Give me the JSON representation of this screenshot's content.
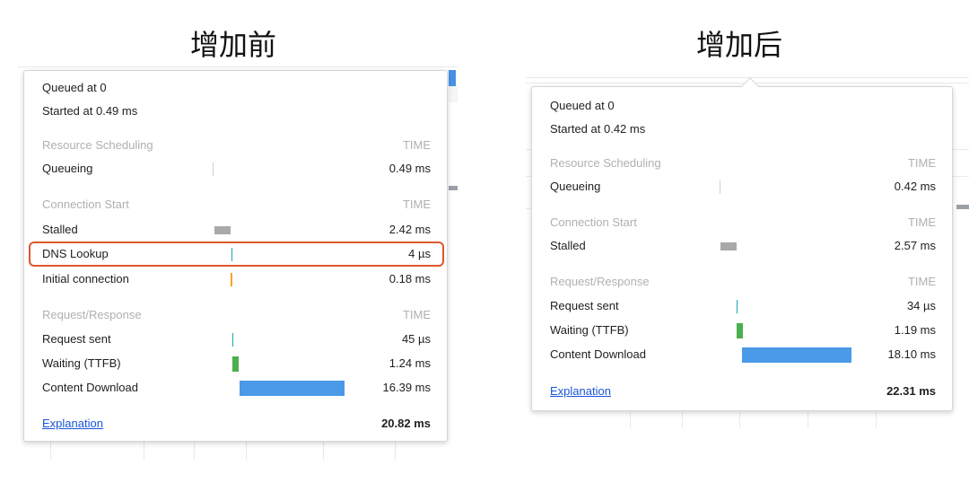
{
  "before": {
    "heading": "增加前",
    "queued": "Queued at 0",
    "started": "Started at 0.49 ms",
    "sections": [
      {
        "title": "Resource Scheduling",
        "time_label": "TIME",
        "rows": [
          {
            "label": "Queueing",
            "value": "0.49 ms"
          }
        ]
      },
      {
        "title": "Connection Start",
        "time_label": "TIME",
        "rows": [
          {
            "label": "Stalled",
            "value": "2.42 ms"
          },
          {
            "label": "DNS Lookup",
            "value": "4 µs"
          },
          {
            "label": "Initial connection",
            "value": "0.18 ms"
          }
        ]
      },
      {
        "title": "Request/Response",
        "time_label": "TIME",
        "rows": [
          {
            "label": "Request sent",
            "value": "45 µs"
          },
          {
            "label": "Waiting (TTFB)",
            "value": "1.24 ms"
          },
          {
            "label": "Content Download",
            "value": "16.39 ms"
          }
        ]
      }
    ],
    "explanation": "Explanation",
    "total": "20.82 ms"
  },
  "after": {
    "heading": "增加后",
    "queued": "Queued at 0",
    "started": "Started at 0.42 ms",
    "sections": [
      {
        "title": "Resource Scheduling",
        "time_label": "TIME",
        "rows": [
          {
            "label": "Queueing",
            "value": "0.42 ms"
          }
        ]
      },
      {
        "title": "Connection Start",
        "time_label": "TIME",
        "rows": [
          {
            "label": "Stalled",
            "value": "2.57 ms"
          }
        ]
      },
      {
        "title": "Request/Response",
        "time_label": "TIME",
        "rows": [
          {
            "label": "Request sent",
            "value": "34 µs"
          },
          {
            "label": "Waiting (TTFB)",
            "value": "1.19 ms"
          },
          {
            "label": "Content Download",
            "value": "18.10 ms"
          }
        ]
      }
    ],
    "explanation": "Explanation",
    "total": "22.31 ms"
  },
  "colors": {
    "highlight": "#e0562e",
    "link": "#1a55d8",
    "download_bar": "#4a9ae8",
    "ttfb_bar": "#4caf50",
    "stalled_bar": "#a9a9a9"
  }
}
